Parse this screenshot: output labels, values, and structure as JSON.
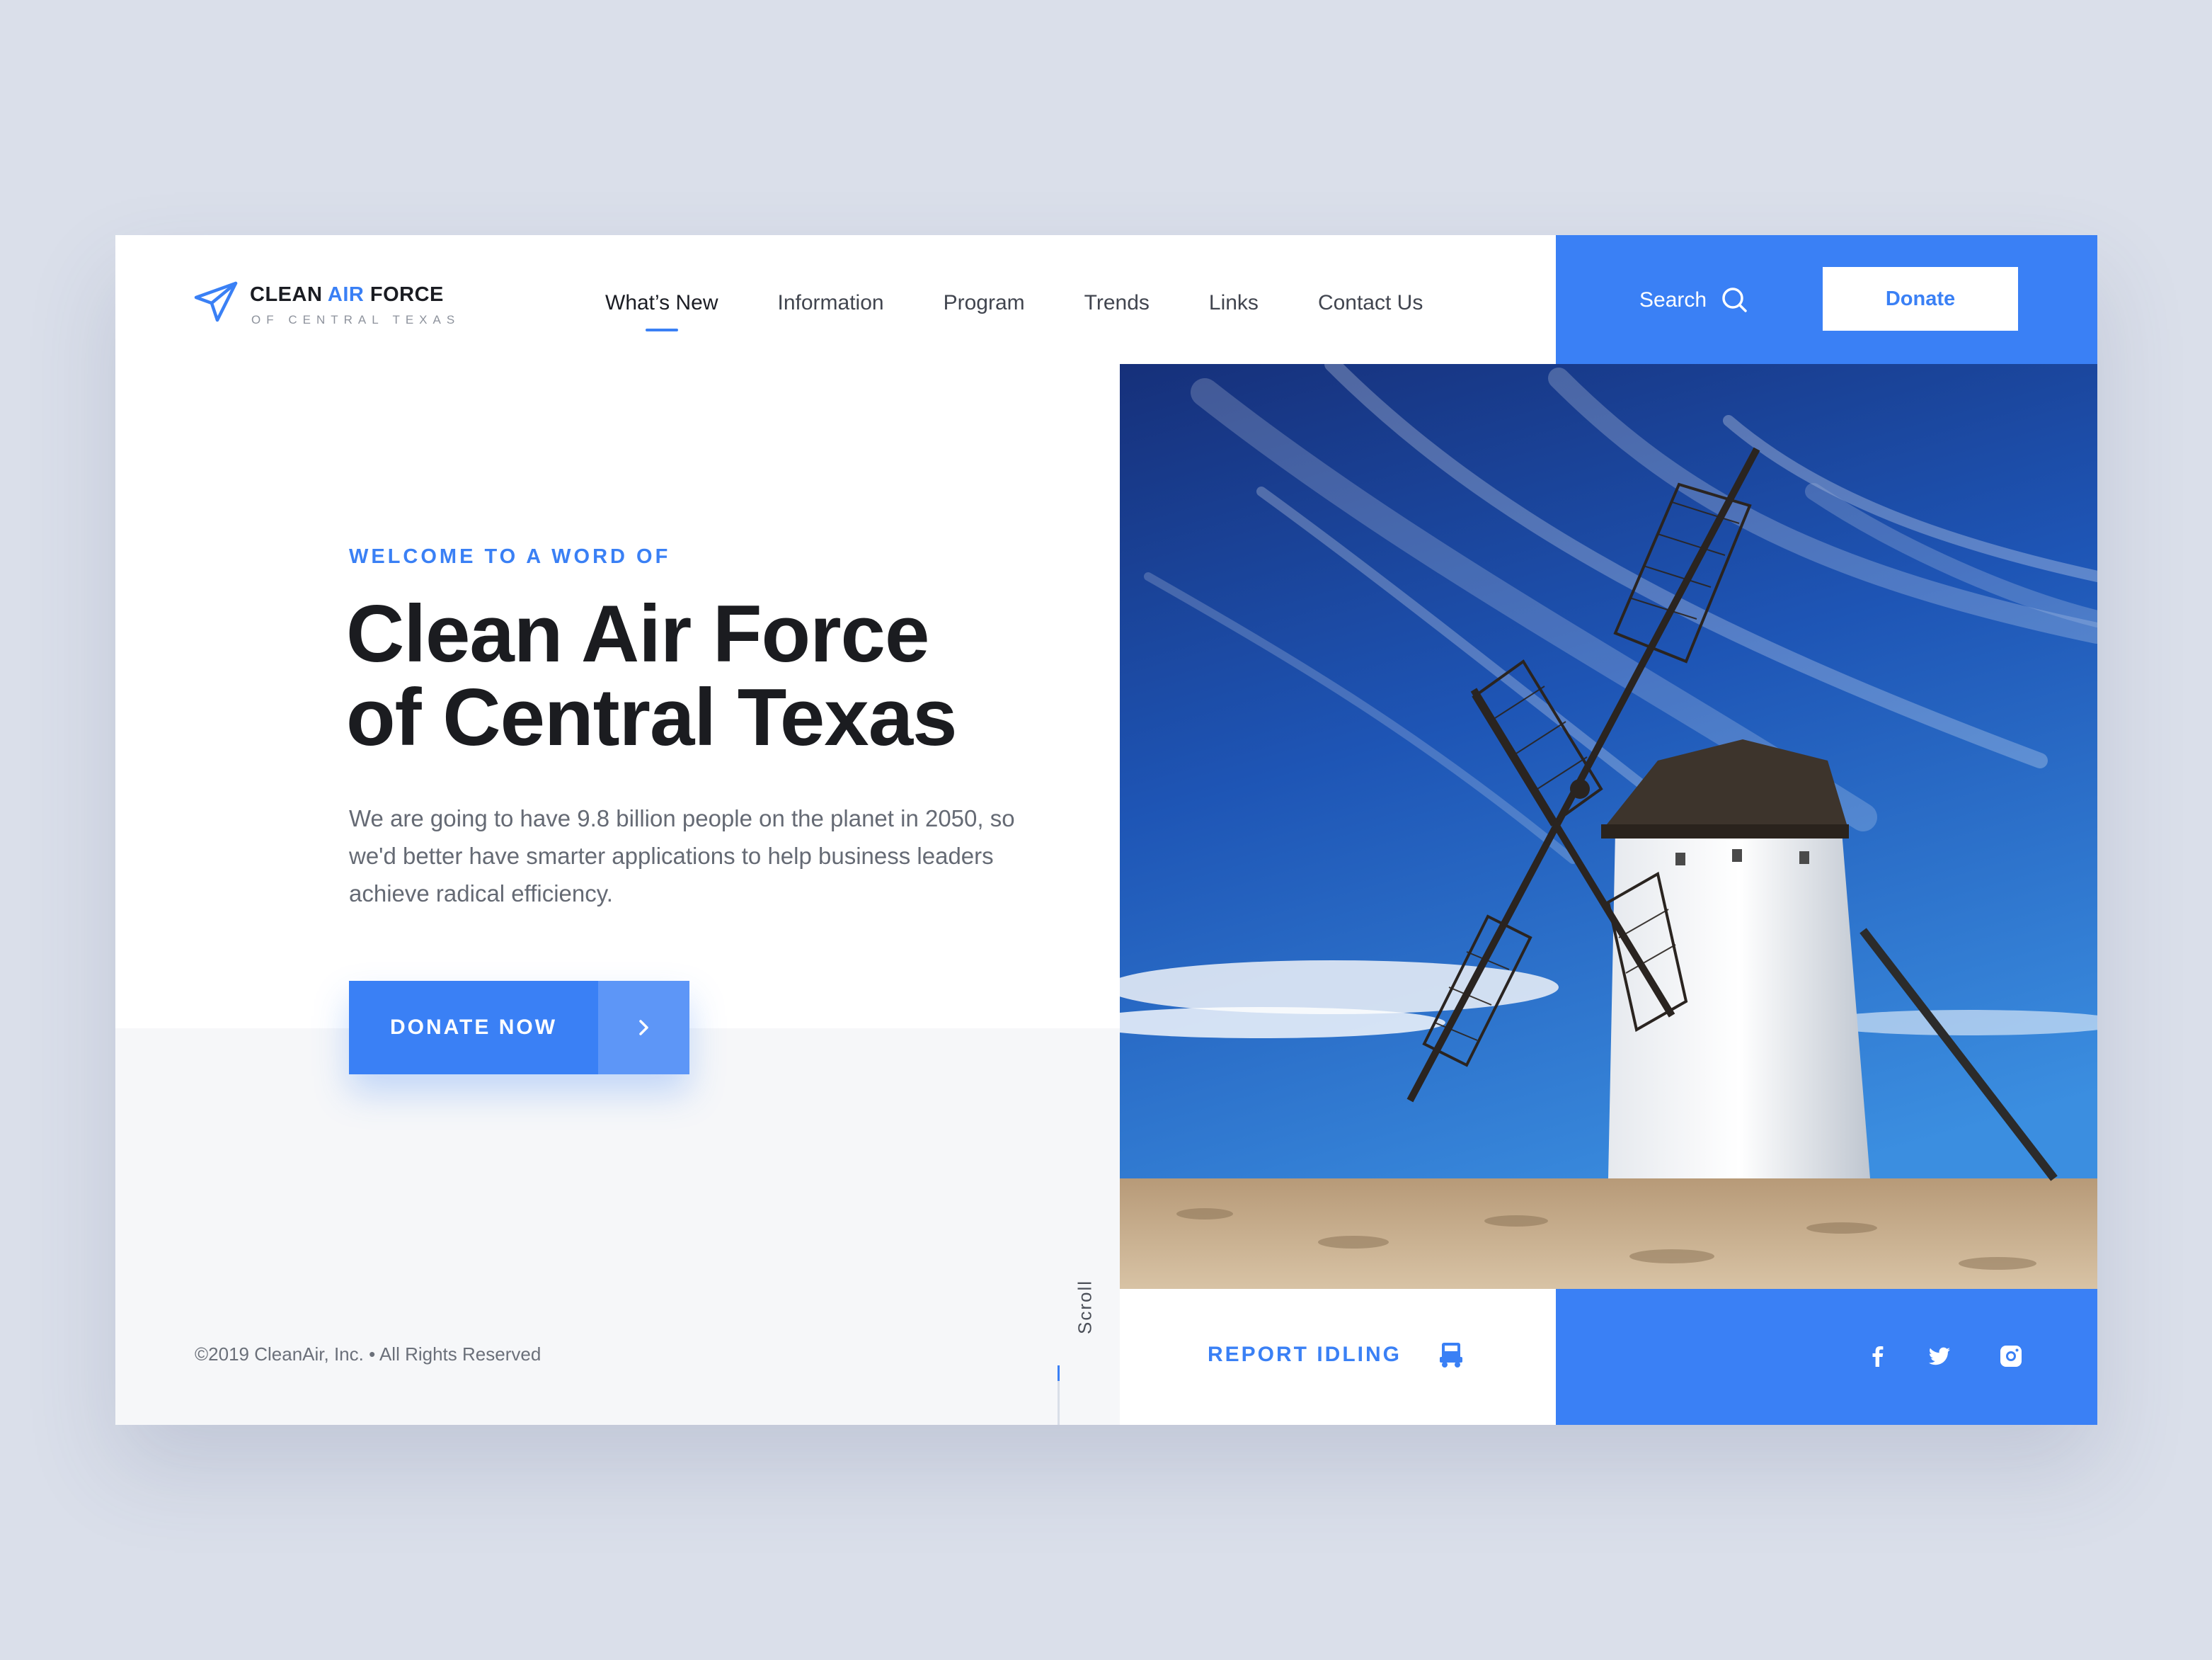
{
  "brand": {
    "title_part1": "CLEAN",
    "title_accent": "AIR",
    "title_part2": "FORCE",
    "subtitle": "OF CENTRAL TEXAS",
    "logo_icon": "paper-plane-icon"
  },
  "nav": {
    "items": [
      {
        "label": "What’s New",
        "active": true
      },
      {
        "label": "Information",
        "active": false
      },
      {
        "label": "Program",
        "active": false
      },
      {
        "label": "Trends",
        "active": false
      },
      {
        "label": "Links",
        "active": false
      },
      {
        "label": "Contact Us",
        "active": false
      }
    ]
  },
  "header": {
    "search_label": "Search",
    "search_icon": "search-icon",
    "donate_label": "Donate"
  },
  "hero": {
    "eyebrow": "WELCOME TO A WORD OF",
    "title_line1": "Clean Air Force",
    "title_line2": "of Central Texas",
    "description": "We are going to have 9.8 billion people on the planet in 2050, so we'd better have smarter applications to help business leaders achieve radical efficiency.",
    "cta_label": "DONATE NOW",
    "cta_icon": "chevron-right-icon"
  },
  "footer": {
    "copyright": "©2019 CleanAir, Inc. • All Rights Reserved",
    "scroll_label": "Scroll",
    "report_label": "REPORT IDLING",
    "report_icon": "truck-icon",
    "social_icons": [
      "facebook-icon",
      "twitter-icon",
      "instagram-icon"
    ]
  },
  "image": {
    "subject": "windmill-photo"
  },
  "colors": {
    "accent": "#3a80f5",
    "accent_light": "#5d96f7",
    "page_bg": "#dadfea",
    "heading": "#1b1c20",
    "body_text": "#656a74"
  }
}
